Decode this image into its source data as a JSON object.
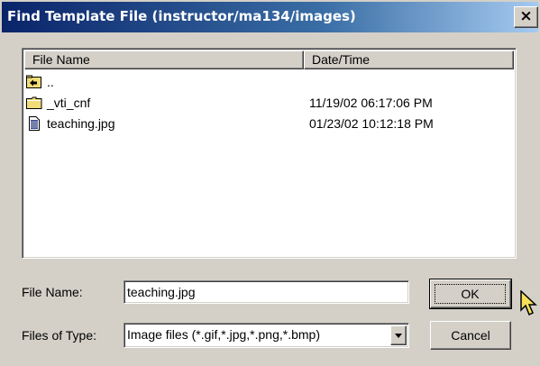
{
  "window": {
    "title": "Find Template File (instructor/ma134/images)",
    "close_label": "×"
  },
  "list": {
    "columns": [
      "File Name",
      "Date/Time"
    ],
    "items": [
      {
        "icon": "parent-folder-icon",
        "name": "..",
        "date": ""
      },
      {
        "icon": "folder-icon",
        "name": "_vti_cnf",
        "date": "11/19/02 06:17:06 PM"
      },
      {
        "icon": "image-file-icon",
        "name": "teaching.jpg",
        "date": "01/23/02 10:12:18 PM"
      }
    ]
  },
  "form": {
    "file_name_label": "File Name:",
    "file_name_value": "teaching.jpg",
    "file_type_label": "Files of Type:",
    "file_type_value": "Image files (*.gif,*.jpg,*.png,*.bmp)"
  },
  "buttons": {
    "ok_label": "OK",
    "cancel_label": "Cancel"
  },
  "colors": {
    "title_start": "#0a246a",
    "title_end": "#a6caf0",
    "face": "#d4d0c8",
    "folder": "#f0dc78"
  }
}
